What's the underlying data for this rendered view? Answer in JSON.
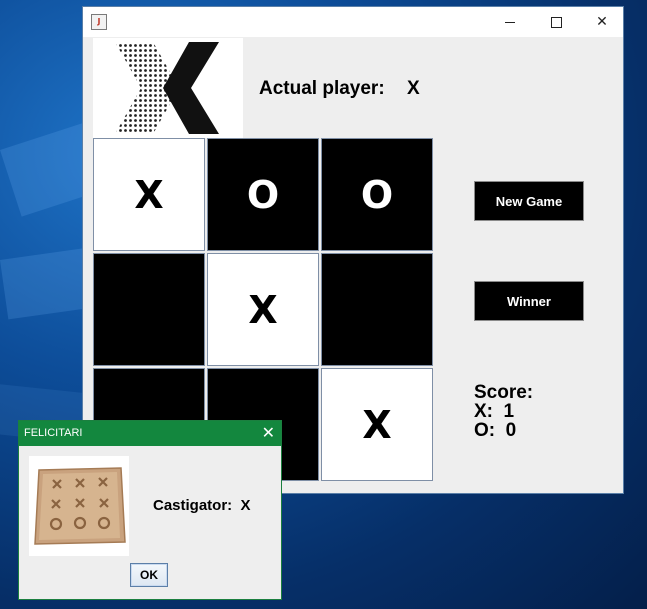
{
  "window": {
    "title": "",
    "controls": {
      "minimize": "minimize-icon",
      "maximize": "maximize-icon",
      "close": "✕"
    }
  },
  "game": {
    "player_label": "Actual player:",
    "player_value": "X",
    "board": [
      {
        "mark": "X",
        "color": "white"
      },
      {
        "mark": "O",
        "color": "black"
      },
      {
        "mark": "O",
        "color": "black"
      },
      {
        "mark": "",
        "color": "black"
      },
      {
        "mark": "X",
        "color": "white"
      },
      {
        "mark": "",
        "color": "black"
      },
      {
        "mark": "",
        "color": "black"
      },
      {
        "mark": "",
        "color": "black"
      },
      {
        "mark": "X",
        "color": "white"
      }
    ],
    "buttons": {
      "new_game": "New Game",
      "winner": "Winner"
    },
    "score": {
      "title": "Score:",
      "x_line": "X:  1",
      "o_line": "O:  0"
    }
  },
  "dialog": {
    "title": "FELICITARI",
    "close": "✕",
    "message": "Castigator:  X",
    "ok": "OK"
  },
  "colors": {
    "titlebar": "#ffffff",
    "window_bg": "#eeeeee",
    "dialog_title": "#13873e",
    "cell_dark": "#000000",
    "cell_light": "#ffffff"
  }
}
